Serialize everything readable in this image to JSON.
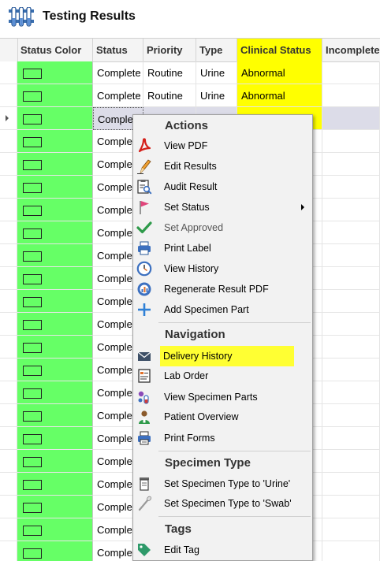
{
  "window": {
    "title": "Testing Results",
    "icon": "test-tubes-icon"
  },
  "grid": {
    "columns": [
      "Status Color",
      "Status",
      "Priority",
      "Type",
      "Clinical Status",
      "Incomplete"
    ],
    "rows": [
      {
        "status": "Complete",
        "priority": "Routine",
        "type": "Urine",
        "clinical": "Abnormal"
      },
      {
        "status": "Complete",
        "priority": "Routine",
        "type": "Urine",
        "clinical": "Abnormal"
      },
      {
        "status": "Complete",
        "priority": "",
        "type": "",
        "clinical": ""
      },
      {
        "status": "Complete",
        "priority": "",
        "type": "",
        "clinical": ""
      },
      {
        "status": "Complete",
        "priority": "",
        "type": "",
        "clinical": ""
      },
      {
        "status": "Complete",
        "priority": "",
        "type": "",
        "clinical": ""
      },
      {
        "status": "Complete",
        "priority": "",
        "type": "",
        "clinical": ""
      },
      {
        "status": "Complete",
        "priority": "",
        "type": "",
        "clinical": ""
      },
      {
        "status": "Complete",
        "priority": "",
        "type": "",
        "clinical": ""
      },
      {
        "status": "Complete",
        "priority": "",
        "type": "",
        "clinical": ""
      },
      {
        "status": "Complete",
        "priority": "",
        "type": "",
        "clinical": ""
      },
      {
        "status": "Complete",
        "priority": "",
        "type": "",
        "clinical": ""
      },
      {
        "status": "Complete",
        "priority": "",
        "type": "",
        "clinical": ""
      },
      {
        "status": "Complete",
        "priority": "",
        "type": "",
        "clinical": ""
      },
      {
        "status": "Complete",
        "priority": "",
        "type": "",
        "clinical": ""
      },
      {
        "status": "Complete",
        "priority": "",
        "type": "",
        "clinical": ""
      },
      {
        "status": "Complete",
        "priority": "",
        "type": "",
        "clinical": ""
      },
      {
        "status": "Complete",
        "priority": "",
        "type": "",
        "clinical": ""
      },
      {
        "status": "Complete",
        "priority": "",
        "type": "",
        "clinical": ""
      },
      {
        "status": "Complete",
        "priority": "",
        "type": "",
        "clinical": ""
      },
      {
        "status": "Complete",
        "priority": "",
        "type": "",
        "clinical": ""
      },
      {
        "status": "Complete",
        "priority": "",
        "type": "",
        "clinical": ""
      },
      {
        "status": "Complete",
        "priority": "",
        "type": "",
        "clinical": ""
      }
    ],
    "selected_row": 2,
    "colors": {
      "status_green": "#66ff66",
      "abnormal_yellow": "#ffff00",
      "selection": "#dcdce8"
    }
  },
  "context_menu": {
    "sections": {
      "actions": "Actions",
      "navigation": "Navigation",
      "specimen_type": "Specimen Type",
      "tags": "Tags"
    },
    "items": {
      "view_pdf": {
        "label": "View PDF",
        "icon": "pdf-icon"
      },
      "edit_results": {
        "label": "Edit Results",
        "icon": "pencil-icon"
      },
      "audit_result": {
        "label": "Audit Result",
        "icon": "audit-clipboard-icon"
      },
      "set_status": {
        "label": "Set Status",
        "icon": "flag-icon"
      },
      "set_approved": {
        "label": "Set Approved",
        "icon": "checkmark-icon"
      },
      "print_label": {
        "label": "Print Label",
        "icon": "printer-icon"
      },
      "view_history": {
        "label": "View History",
        "icon": "clock-icon"
      },
      "regenerate_pdf": {
        "label": "Regenerate Result PDF",
        "icon": "chart-gauge-icon"
      },
      "add_specimen_part": {
        "label": "Add Specimen Part",
        "icon": "plus-icon"
      },
      "delivery_history": {
        "label": "Delivery History",
        "icon": "envelope-icon"
      },
      "lab_order": {
        "label": "Lab Order",
        "icon": "order-form-icon"
      },
      "view_specimen_parts": {
        "label": "View Specimen Parts",
        "icon": "specimen-parts-icon"
      },
      "patient_overview": {
        "label": "Patient Overview",
        "icon": "patient-icon"
      },
      "print_forms": {
        "label": "Print Forms",
        "icon": "printer-forms-icon"
      },
      "set_type_urine": {
        "label": "Set Specimen Type to 'Urine'",
        "icon": "urine-cup-icon"
      },
      "set_type_swab": {
        "label": "Set Specimen Type to 'Swab'",
        "icon": "swab-icon"
      },
      "edit_tag": {
        "label": "Edit Tag",
        "icon": "tag-icon"
      }
    },
    "highlight_color": "#ffff33"
  }
}
